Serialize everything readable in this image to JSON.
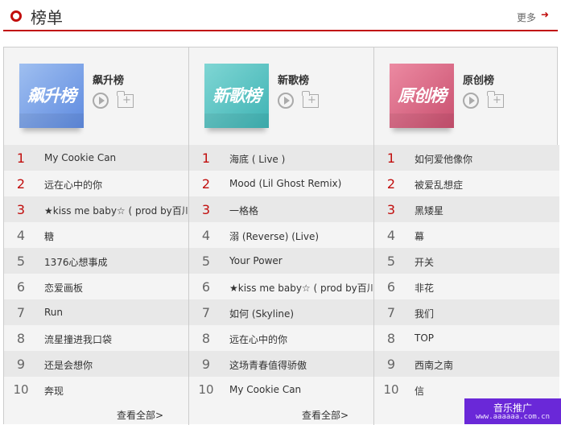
{
  "header": {
    "title": "榜单",
    "more": "更多",
    "more_arrow": "➜"
  },
  "boards": [
    {
      "cover_text": "飙升榜",
      "name": "飙升榜",
      "songs": [
        "My Cookie Can",
        "远在心中的你",
        "★kiss me baby☆ ( prod by百川)",
        "糖",
        "1376心想事成",
        "恋爱画板",
        "Run",
        "流星撞进我口袋",
        "还是会想你",
        "奔现"
      ]
    },
    {
      "cover_text": "新歌榜",
      "name": "新歌榜",
      "songs": [
        "海底 ( Live )",
        "Mood (Lil Ghost Remix)",
        "一格格",
        "溺 (Reverse) (Live)",
        "Your Power",
        "★kiss me baby☆ ( prod by百川)",
        "如何 (Skyline)",
        "远在心中的你",
        "这场青春值得骄傲",
        "My Cookie Can"
      ]
    },
    {
      "cover_text": "原创榜",
      "name": "原创榜",
      "songs": [
        "如何爱他像你",
        "被爱乱想症",
        "黑矮星",
        "幕",
        "开关",
        "非花",
        "我们",
        "TOP",
        "西南之南",
        "信"
      ]
    }
  ],
  "ranks": [
    "1",
    "2",
    "3",
    "4",
    "5",
    "6",
    "7",
    "8",
    "9",
    "10"
  ],
  "view_all": "查看全部>",
  "ad": {
    "line1": "音乐推广",
    "line2": "www.aaaaaa.com.cn"
  },
  "colors": {
    "accent": "#c10d0c",
    "ad_bg": "#6a28d8"
  }
}
